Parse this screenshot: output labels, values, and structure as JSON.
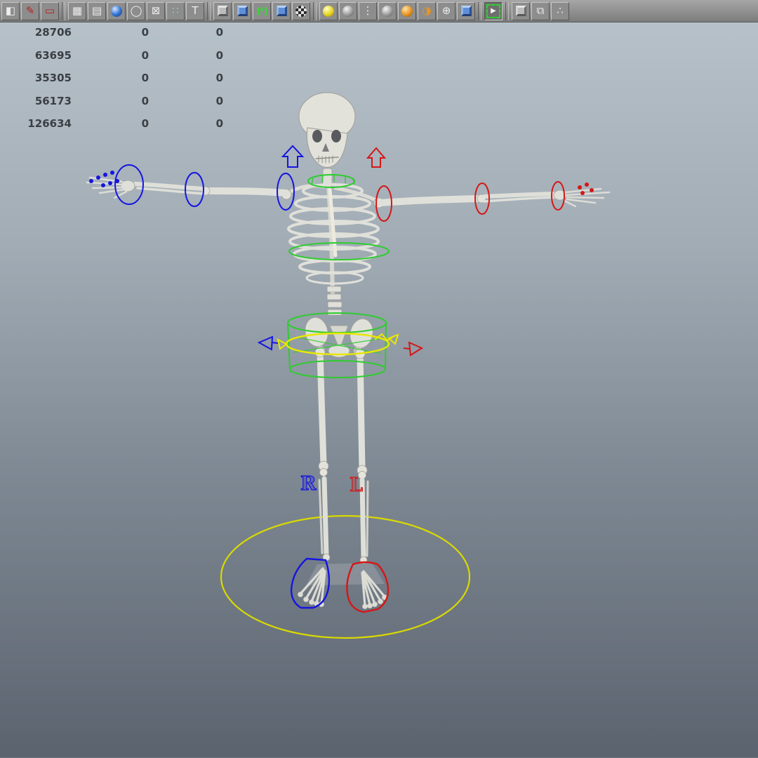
{
  "app": {
    "title": "3D viewport with rigged skeleton"
  },
  "toolbar": {
    "icons": [
      {
        "name": "object-selection-mask-icon",
        "glyph": "◧"
      },
      {
        "name": "pen-tool-icon",
        "glyph": "✎"
      },
      {
        "name": "eraser-tool-icon",
        "glyph": "▭"
      },
      {
        "name": "grid-icon",
        "glyph": "▦"
      },
      {
        "name": "film-gate-icon",
        "glyph": "▤"
      },
      {
        "name": "snap-to-grid-icon",
        "glyph": ""
      },
      {
        "name": "snap-to-curve-icon",
        "glyph": "◯"
      },
      {
        "name": "snap-to-point-icon",
        "glyph": "⊠"
      },
      {
        "name": "snap-to-plane-icon",
        "glyph": "∷"
      },
      {
        "name": "text-tool-icon",
        "glyph": "T"
      },
      {
        "name": "input-connections-icon",
        "glyph": ""
      },
      {
        "name": "output-connections-icon",
        "glyph": ""
      },
      {
        "name": "construction-history-icon",
        "glyph": "[*]"
      },
      {
        "name": "render-cube-icon",
        "glyph": ""
      },
      {
        "name": "checker-sphere-icon",
        "glyph": ""
      },
      {
        "name": "render-current-frame-icon",
        "glyph": ""
      },
      {
        "name": "ipr-render-icon",
        "glyph": ""
      },
      {
        "name": "render-diagnostics-icon",
        "glyph": "⋮"
      },
      {
        "name": "ipr-region-icon",
        "glyph": ""
      },
      {
        "name": "render-settings-icon",
        "glyph": ""
      },
      {
        "name": "gamma-display-icon",
        "glyph": "◑"
      },
      {
        "name": "add-node-icon",
        "glyph": "⊕"
      },
      {
        "name": "texture-cube-icon",
        "glyph": ""
      },
      {
        "name": "selection-tool-icon",
        "glyph": "▶"
      },
      {
        "name": "object-mode-cube-icon",
        "glyph": ""
      },
      {
        "name": "duplicate-icon",
        "glyph": "⧉"
      },
      {
        "name": "share-nodes-icon",
        "glyph": "∴"
      }
    ]
  },
  "hud": {
    "rows": [
      {
        "col1": "28706",
        "col2": "0",
        "col3": "0"
      },
      {
        "col1": "63695",
        "col2": "0",
        "col3": "0"
      },
      {
        "col1": "35305",
        "col2": "0",
        "col3": "0"
      },
      {
        "col1": "56173",
        "col2": "0",
        "col3": "0"
      },
      {
        "col1": "126634",
        "col2": "0",
        "col3": "0"
      }
    ]
  },
  "viewport": {
    "labels": {
      "right": "R",
      "left": "L"
    },
    "colors": {
      "right_side_controls": "#1515e0",
      "left_side_controls": "#d41717",
      "center_controls": "#2ecc2e",
      "pelvis_control": "#e8e800",
      "ground_control": "#d9d900",
      "bg_top": "#b6c1c9",
      "bg_bottom": "#5a636e",
      "hud_text": "#3b3f44"
    }
  }
}
